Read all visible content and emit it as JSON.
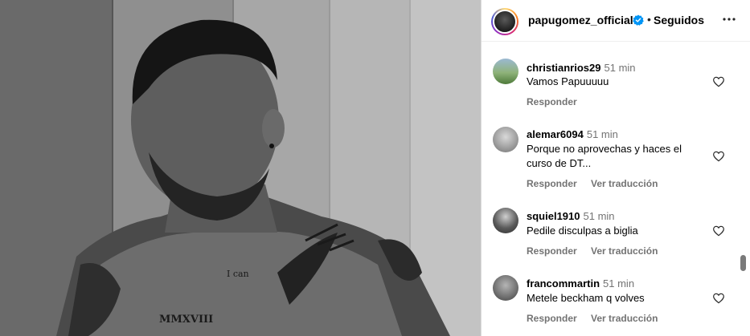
{
  "post": {
    "image_alt": "black and white photo of shirtless tattooed man",
    "tattoos": {
      "chest_small": "I can",
      "chest_roman": "MMXVIII"
    }
  },
  "header": {
    "username": "papugomez_official",
    "separator": "•",
    "follow_label": "Seguidos",
    "verified_icon": "verified-badge-icon",
    "more_icon": "more-options-icon"
  },
  "comments": [
    {
      "username": "christianrios29",
      "time": "51 min",
      "text": "Vamos Papuuuuu",
      "reply_label": "Responder",
      "translate_label": ""
    },
    {
      "username": "alemar6094",
      "time": "51 min",
      "text": "Porque no aprovechas y haces el curso de DT...",
      "reply_label": "Responder",
      "translate_label": "Ver traducción"
    },
    {
      "username": "squiel1910",
      "time": "51 min",
      "text": "Pedile disculpas a biglia",
      "reply_label": "Responder",
      "translate_label": "Ver traducción"
    },
    {
      "username": "francommartin",
      "time": "51 min",
      "text": "Metele beckham q volves",
      "reply_label": "Responder",
      "translate_label": "Ver traducción"
    }
  ],
  "colors": {
    "secondary_text": "#737373",
    "verified_blue": "#0095f6",
    "border": "#dbdbdb"
  }
}
